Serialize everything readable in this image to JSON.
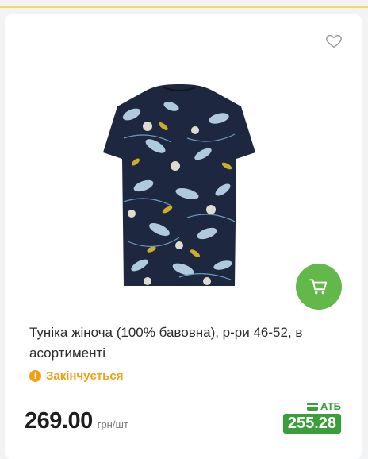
{
  "product": {
    "title": "Туніка жіноча (100% бавовна), р-ри 46-52, в асортименті",
    "status": "Закінчується",
    "price": "269.00",
    "unit": "грн/шт",
    "promo_label": "АТБ",
    "promo_price": "255.28"
  },
  "icons": {
    "favorite": "heart-outline-icon",
    "cart": "cart-icon",
    "status": "warning-icon",
    "promo_card": "card-icon"
  },
  "colors": {
    "accent_green": "#63b84a",
    "promo_green": "#3a9e3a",
    "warning_orange": "#f0a014",
    "top_border_yellow": "#f5d95a"
  }
}
